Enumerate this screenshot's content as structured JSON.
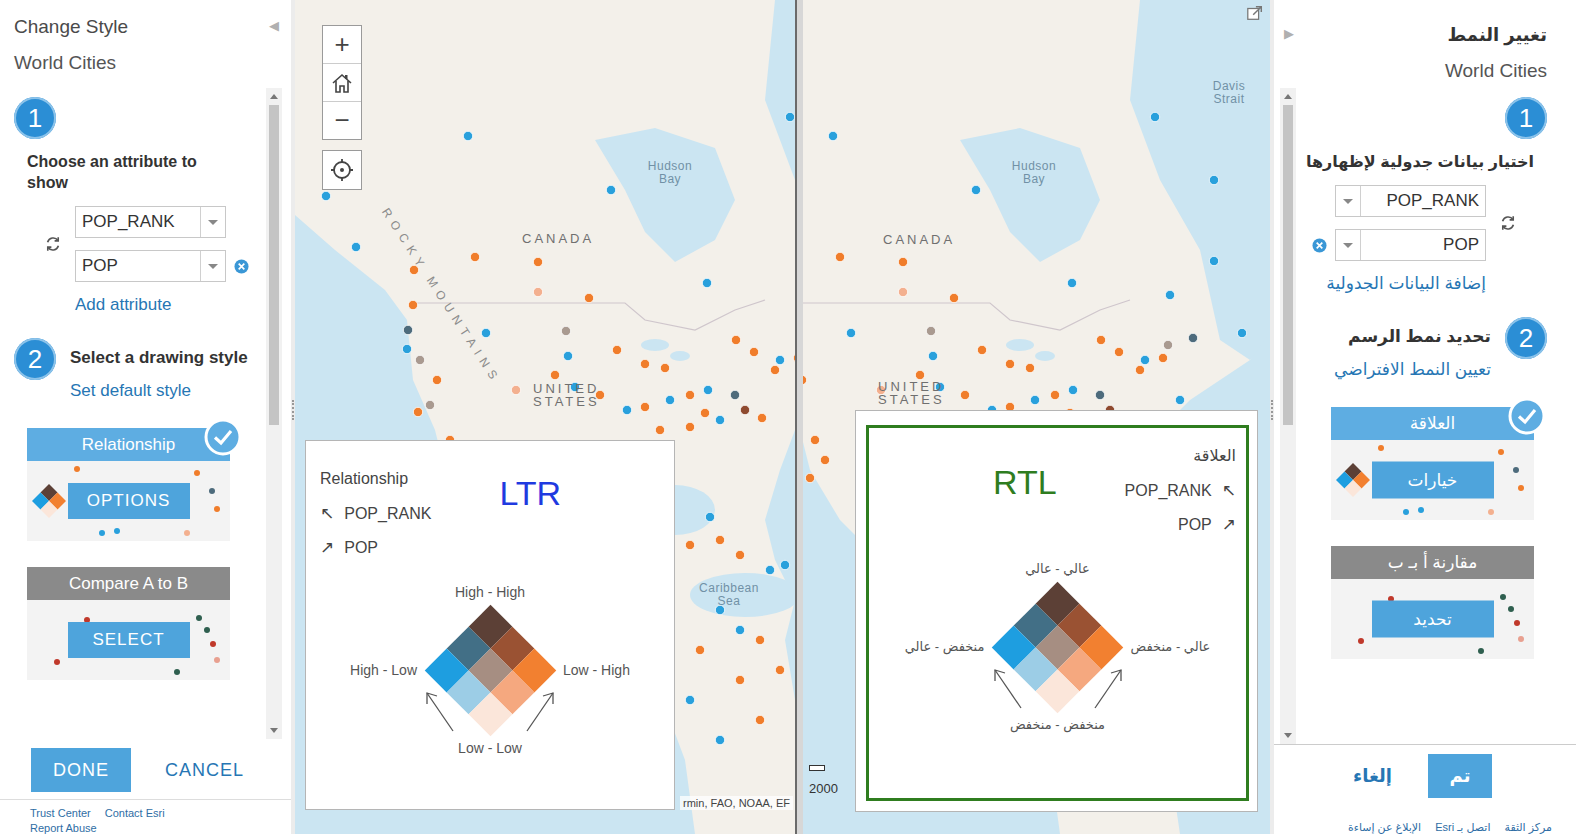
{
  "left_panel": {
    "dir": "ltr",
    "title": "Change Style",
    "layer": "World Cities",
    "collapse_icon": "◀",
    "step1": {
      "number": "1",
      "label": "Choose an attribute to show",
      "attributes": [
        {
          "name": "POP_RANK",
          "removable": false
        },
        {
          "name": "POP",
          "removable": true
        }
      ],
      "add": "Add attribute"
    },
    "step2": {
      "number": "2",
      "label": "Select a drawing style",
      "default_link": "Set default style"
    },
    "styles": [
      {
        "kind": "relationship",
        "title": "Relationship",
        "button": "OPTIONS",
        "selected": true
      },
      {
        "kind": "compare",
        "title": "Compare A to B",
        "button": "SELECT",
        "selected": false
      }
    ],
    "done": "DONE",
    "cancel": "CANCEL",
    "footer": [
      "Trust Center",
      "Contact Esri",
      "Report Abuse"
    ]
  },
  "right_panel": {
    "dir": "rtl",
    "title": "تغيير النمط",
    "layer": "World Cities",
    "collapse_icon": "▶",
    "step1": {
      "number": "1",
      "label": "اختيار بيانات جدولية لإظهارها",
      "attributes": [
        {
          "name": "POP_RANK",
          "removable": false
        },
        {
          "name": "POP",
          "removable": true
        }
      ],
      "add": "إضافة البيانات الجدولية"
    },
    "step2": {
      "number": "2",
      "label": "تحديد نمط الرسم",
      "default_link": "تعيين النمط الافتراضي"
    },
    "styles": [
      {
        "kind": "relationship",
        "title": "العلاقة",
        "button": "خيارات",
        "selected": true
      },
      {
        "kind": "compare",
        "title": "مقارنة أ بـ ب",
        "button": "تحديد",
        "selected": false
      }
    ],
    "done": "تم",
    "cancel": "إلغاء",
    "footer": [
      "مركز الثقة",
      "اتصل بـ Esri",
      "الإبلاغ عن إساءة"
    ]
  },
  "maps": [
    {
      "dir": "ltr",
      "zoom_in": "+",
      "zoom_out": "−",
      "labels": [
        {
          "text": "Hudson Bay",
          "kind": "water"
        },
        {
          "text": "CANADA",
          "kind": "country"
        },
        {
          "text": "ROCKY MOUNTAINS",
          "kind": "range"
        },
        {
          "text": "UNITED STATES",
          "kind": "country"
        },
        {
          "text": "Caribbean Sea",
          "kind": "water"
        }
      ],
      "attribution": "rmin, FAO, NOAA, EF",
      "legend": {
        "dir": "ltr",
        "highlighted": false,
        "title": "Relationship",
        "tag": "LTR",
        "tag_color": "#1f3ae0",
        "fields": [
          {
            "arrow": "↖",
            "name": "POP_RANK"
          },
          {
            "arrow": "↗",
            "name": "POP"
          }
        ],
        "top": "High - High",
        "left": "High - Low",
        "right": "Low - High",
        "bottom": "Low - Low"
      }
    },
    {
      "dir": "rtl",
      "labels": [
        {
          "text": "Davis Strait",
          "kind": "water"
        },
        {
          "text": "Hudson Bay",
          "kind": "water"
        },
        {
          "text": "CANADA",
          "kind": "country"
        },
        {
          "text": "UNITED STATES",
          "kind": "country"
        }
      ],
      "scale": "2000",
      "legend": {
        "dir": "rtl",
        "highlighted": true,
        "title": "العلاقة",
        "tag": "RTL",
        "tag_color": "#2f7d1f",
        "fields": [
          {
            "arrow": "↖",
            "name": "POP_RANK"
          },
          {
            "arrow": "↗",
            "name": "POP"
          }
        ],
        "top": "عالي - عالي",
        "left": "منخفض - عالي",
        "right": "عالي - منخفض",
        "bottom": "منخفض - منخفض"
      }
    }
  ],
  "diamond_cells": [
    {
      "color": "#5c4036"
    },
    {
      "color": "#9a5233"
    },
    {
      "color": "#f28030"
    },
    {
      "color": "#426f86"
    },
    {
      "color": "#a68e82"
    },
    {
      "color": "#f5a87f"
    },
    {
      "color": "#1e9ee0"
    },
    {
      "color": "#9ccde6"
    },
    {
      "color": "#fbe6da"
    }
  ],
  "dots": [
    {
      "color": "#29a0dc"
    },
    {
      "color": "#29a0dc"
    },
    {
      "color": "#29a0dc"
    },
    {
      "color": "#29a0dc"
    },
    {
      "color": "#f07d2b"
    },
    {
      "color": "#f07d2b"
    },
    {
      "color": "#29a0dc"
    },
    {
      "color": "#f07d2b"
    },
    {
      "color": "#f3b08f"
    },
    {
      "color": "#f07d2b"
    },
    {
      "color": "#f07d2b"
    },
    {
      "color": "#4d6b7c"
    },
    {
      "color": "#29a0dc"
    },
    {
      "color": "#29a0dc"
    },
    {
      "color": "#a99a90"
    },
    {
      "color": "#f07d2b"
    },
    {
      "color": "#29a0dc"
    },
    {
      "color": "#f07d2b"
    },
    {
      "color": "#f07d2b"
    },
    {
      "color": "#f07d2b"
    },
    {
      "color": "#f07d2b"
    },
    {
      "color": "#a99a90"
    },
    {
      "color": "#f07d2b"
    },
    {
      "color": "#f3b08f"
    },
    {
      "color": "#a99a90"
    },
    {
      "color": "#f07d2b"
    },
    {
      "color": "#f07d2b"
    },
    {
      "color": "#29a0dc"
    },
    {
      "color": "#f07d2b"
    },
    {
      "color": "#29a0dc"
    },
    {
      "color": "#f07d2b"
    },
    {
      "color": "#29a0dc"
    },
    {
      "color": "#f07d2b"
    },
    {
      "color": "#29a0dc"
    },
    {
      "color": "#4d6b7c"
    },
    {
      "color": "#8e4a2f"
    },
    {
      "color": "#f07d2b"
    },
    {
      "color": "#f07d2b"
    },
    {
      "color": "#29a0dc"
    },
    {
      "color": "#29a0dc"
    },
    {
      "color": "#f07d2b"
    },
    {
      "color": "#f07d2b"
    },
    {
      "color": "#f07d2b"
    },
    {
      "color": "#29a0dc"
    },
    {
      "color": "#f07d2b"
    },
    {
      "color": "#f07d2b"
    },
    {
      "color": "#f07d2b"
    },
    {
      "color": "#29a0dc"
    },
    {
      "color": "#29a0dc"
    },
    {
      "color": "#29a0dc"
    },
    {
      "color": "#29a0dc"
    },
    {
      "color": "#f07d2b"
    },
    {
      "color": "#f07d2b"
    },
    {
      "color": "#f07d2b"
    },
    {
      "color": "#f07d2b"
    },
    {
      "color": "#29a0dc"
    },
    {
      "color": "#f07d2b"
    },
    {
      "color": "#29a0dc"
    },
    {
      "color": "#29a0dc"
    },
    {
      "color": "#29a0dc"
    },
    {
      "color": "#29a0dc"
    },
    {
      "color": "#29a0dc"
    },
    {
      "color": "#29a0dc"
    },
    {
      "color": "#4d6b7c"
    },
    {
      "color": "#a99a90"
    },
    {
      "color": "#f07d2b"
    },
    {
      "color": "#f07d2b"
    },
    {
      "color": "#f07d2b"
    },
    {
      "color": "#f07d2b"
    },
    {
      "color": "#29a0dc"
    }
  ]
}
